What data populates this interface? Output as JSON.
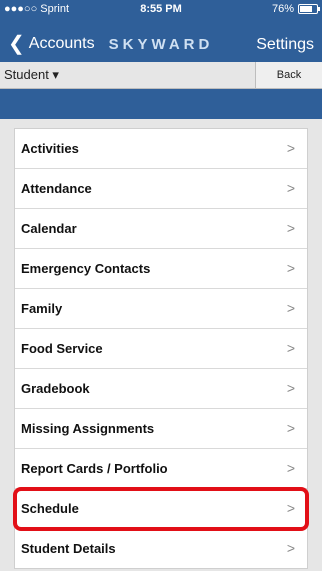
{
  "status": {
    "carrier": "●●●○○ Sprint",
    "time": "8:55 PM",
    "battery": "76%",
    "battery_level": 0.76
  },
  "nav": {
    "back_label": "Accounts",
    "brand": "SKYWARD",
    "settings_label": "Settings"
  },
  "subbar": {
    "student_label": "Student ▾",
    "back_button": "Back"
  },
  "menu": {
    "items": [
      {
        "label": "Activities",
        "chevron": ">"
      },
      {
        "label": "Attendance",
        "chevron": ">"
      },
      {
        "label": "Calendar",
        "chevron": ">"
      },
      {
        "label": "Emergency Contacts",
        "chevron": ">"
      },
      {
        "label": "Family",
        "chevron": ">"
      },
      {
        "label": "Food Service",
        "chevron": ">"
      },
      {
        "label": "Gradebook",
        "chevron": ">"
      },
      {
        "label": "Missing Assignments",
        "chevron": ">"
      },
      {
        "label": "Report Cards / Portfolio",
        "chevron": ">"
      },
      {
        "label": "Schedule",
        "chevron": ">"
      },
      {
        "label": "Student Details",
        "chevron": ">"
      }
    ],
    "highlighted_index": 9,
    "highlight_color": "#e20f17"
  },
  "colors": {
    "header_blue": "#2f5f99"
  }
}
